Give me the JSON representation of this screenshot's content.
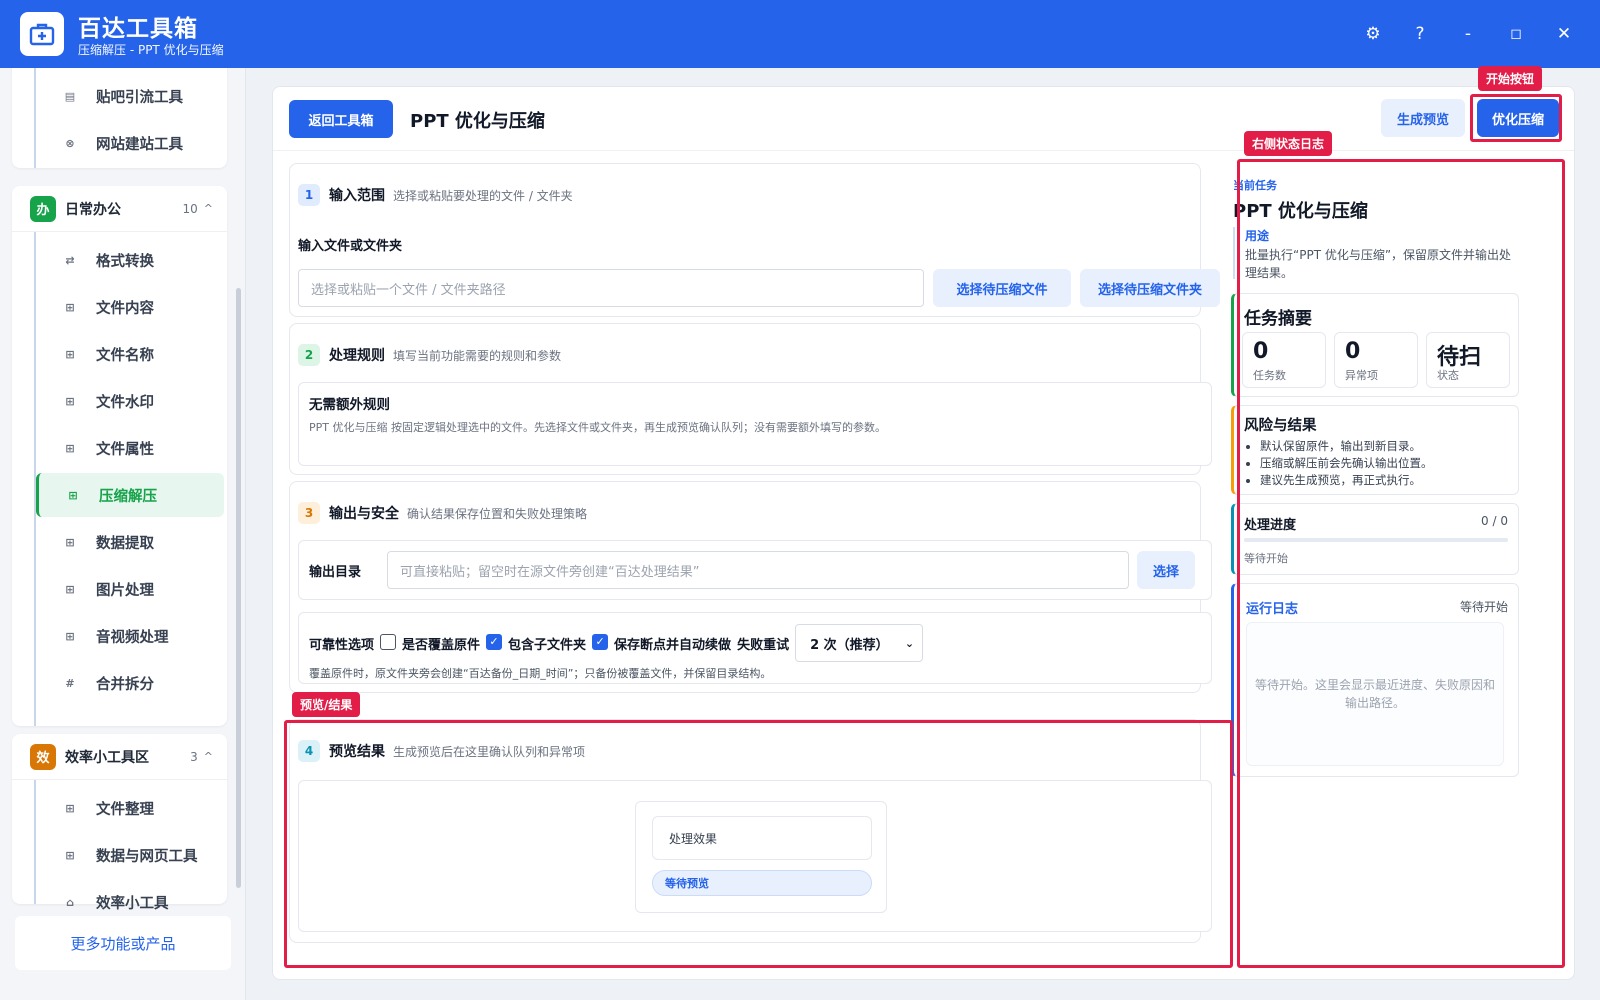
{
  "app": {
    "title": "百达工具箱",
    "subtitle": "压缩解压 - PPT 优化与压缩",
    "window_controls": [
      "⚙",
      "?",
      "-",
      "◻",
      "✕"
    ]
  },
  "sidebar": {
    "top_items": [
      {
        "label": "贴吧引流工具",
        "icon": "doc-icon"
      },
      {
        "label": "网站建站工具",
        "icon": "globe-icon"
      }
    ],
    "groups": [
      {
        "badge": "办",
        "title": "日常办公",
        "count": "10",
        "caret": "^",
        "items": [
          {
            "label": "格式转换",
            "glyph": "⇄"
          },
          {
            "label": "文件内容",
            "glyph": "⊞"
          },
          {
            "label": "文件名称",
            "glyph": "⊞"
          },
          {
            "label": "文件水印",
            "glyph": "⊞"
          },
          {
            "label": "文件属性",
            "glyph": "⊞"
          },
          {
            "label": "压缩解压",
            "glyph": "⊞",
            "active": true
          },
          {
            "label": "数据提取",
            "glyph": "⊞"
          },
          {
            "label": "图片处理",
            "glyph": "⊞"
          },
          {
            "label": "音视频处理",
            "glyph": "⊞"
          },
          {
            "label": "合并拆分",
            "glyph": "#"
          }
        ]
      },
      {
        "badge": "效",
        "title": "效率小工具区",
        "count": "3",
        "caret": "^",
        "items": [
          {
            "label": "文件整理",
            "glyph": "⊞"
          },
          {
            "label": "数据与网页工具",
            "glyph": "⊞"
          },
          {
            "label": "效率小工具",
            "glyph": "⌂"
          }
        ]
      }
    ],
    "more_label": "更多功能或产品"
  },
  "header": {
    "back_label": "返回工具箱",
    "page_title": "PPT 优化与压缩",
    "preview_label": "生成预览",
    "run_label": "优化压缩"
  },
  "sections": {
    "input": {
      "num": "1",
      "title": "输入范围",
      "desc": "选择或粘贴要处理的文件 / 文件夹",
      "field_label": "输入文件或文件夹",
      "placeholder": "选择或粘贴一个文件 / 文件夹路径",
      "pick_file": "选择待压缩文件",
      "pick_folder": "选择待压缩文件夹"
    },
    "rules": {
      "num": "2",
      "title": "处理规则",
      "desc": "填写当前功能需要的规则和参数",
      "box_title": "无需额外规则",
      "box_text": "PPT 优化与压缩 按固定逻辑处理选中的文件。先选择文件或文件夹，再生成预览确认队列；没有需要额外填写的参数。"
    },
    "output": {
      "num": "3",
      "title": "输出与安全",
      "desc": "确认结果保存位置和失败处理策略",
      "dir_label": "输出目录",
      "dir_placeholder": "可直接粘贴；留空时在源文件旁创建“百达处理结果”",
      "dir_btn": "选择",
      "opts_label": "可靠性选项",
      "opt_overwrite": "是否覆盖原件",
      "opt_subfolders": "包含子文件夹",
      "opt_resume": "保存断点并自动续做",
      "retry_label": "失败重试",
      "retry_value": "2 次（推荐）",
      "note": "覆盖原件时，原文件夹旁会创建“百达备份_日期_时间”；只备份被覆盖文件，并保留目录结构。"
    },
    "preview": {
      "num": "4",
      "title": "预览结果",
      "desc": "生成预览后在这里确认队列和异常项",
      "effect_label": "处理效果",
      "status_pill": "等待预览"
    }
  },
  "right": {
    "current_label": "当前任务",
    "task_title": "PPT 优化与压缩",
    "usage_label": "用途",
    "usage_text": "批量执行“PPT 优化与压缩”，保留原文件并输出处理结果。",
    "summary_title": "任务摘要",
    "stats": [
      {
        "value": "0",
        "label": "任务数"
      },
      {
        "value": "0",
        "label": "异常项"
      },
      {
        "value": "待扫",
        "label": "状态"
      }
    ],
    "risk_title": "风险与结果",
    "risk_items": [
      "默认保留原件，输出到新目录。",
      "压缩或解压前会先确认输出位置。",
      "建议先生成预览，再正式执行。"
    ],
    "progress_title": "处理进度",
    "progress_count": "0 / 0",
    "progress_fraction": 0,
    "progress_status": "等待开始",
    "log_title": "运行日志",
    "log_status": "等待开始",
    "log_placeholder": "等待开始。这里会显示最近进度、失败原因和输出路径。"
  },
  "annotations": {
    "start": "开始按钮",
    "log": "右侧状态日志",
    "preview": "预览/结果"
  },
  "colors": {
    "accent": "#2563eb",
    "active": "#16a34a",
    "annotation": "#e11d48",
    "badge_office": "#16a34a",
    "badge_eff": "#d97706"
  }
}
